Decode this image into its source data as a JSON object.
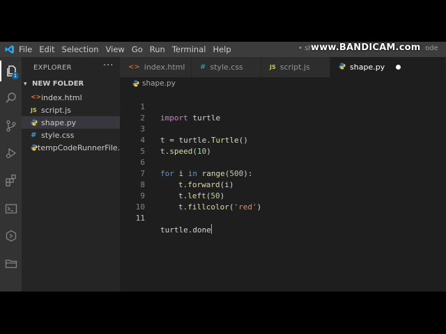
{
  "menu": {
    "items": [
      "File",
      "Edit",
      "Selection",
      "View",
      "Go",
      "Run",
      "Terminal",
      "Help"
    ],
    "title_prefix": "• sh",
    "watermark": "www.BANDICAM.com",
    "title_suffix": "ode"
  },
  "activity": {
    "explorer_badge": "1"
  },
  "sidebar": {
    "title": "EXPLORER",
    "more": "···",
    "folder": "NEW FOLDER",
    "files": [
      {
        "name": "index.html",
        "icon": "html"
      },
      {
        "name": "script.js",
        "icon": "js"
      },
      {
        "name": "shape.py",
        "icon": "py"
      },
      {
        "name": "style.css",
        "icon": "css"
      },
      {
        "name": "tempCodeRunnerFile...",
        "icon": "py"
      }
    ]
  },
  "tabs": [
    {
      "label": "index.html",
      "icon": "html"
    },
    {
      "label": "style.css",
      "icon": "css"
    },
    {
      "label": "script.js",
      "icon": "js"
    },
    {
      "label": "shape.py",
      "icon": "py"
    }
  ],
  "breadcrumb": "shape.py",
  "editor": {
    "line_numbers": [
      "1",
      "2",
      "3",
      "4",
      "5",
      "6",
      "7",
      "8",
      "9",
      "10",
      "11"
    ],
    "code": {
      "l1_kw": "import",
      "l1_mod": " turtle",
      "l3_var": "t",
      "l3_eq": " = turtle.",
      "l3_cls": "Turtle",
      "l3_paren": "()",
      "l4_a": "t.",
      "l4_fn": "speed",
      "l4_open": "(",
      "l4_num": "10",
      "l4_close": ")",
      "l6_for": "for",
      "l6_i": " i ",
      "l6_in": "in",
      "l6_sp": " ",
      "l6_fn": "range",
      "l6_open": "(",
      "l6_num": "500",
      "l6_close": "):",
      "l7_a": "t.",
      "l7_fn": "forward",
      "l7_open": "(",
      "l7_i": "i",
      "l7_close": ")",
      "l8_a": "t.",
      "l8_fn": "left",
      "l8_open": "(",
      "l8_num": "50",
      "l8_close": ")",
      "l9_a": "t.",
      "l9_fn": "fillcolor",
      "l9_open": "(",
      "l9_str": "'red'",
      "l9_close": ")",
      "l11_a": "turtle.",
      "l11_fn": "done"
    }
  },
  "colors": {
    "keyword_purple": "#c586c0",
    "keyword_blue": "#569cd6",
    "function": "#dcdcaa",
    "number": "#b5cea8",
    "string": "#ce9178",
    "class": "#4ec9b0",
    "accent": "#0e639c"
  }
}
